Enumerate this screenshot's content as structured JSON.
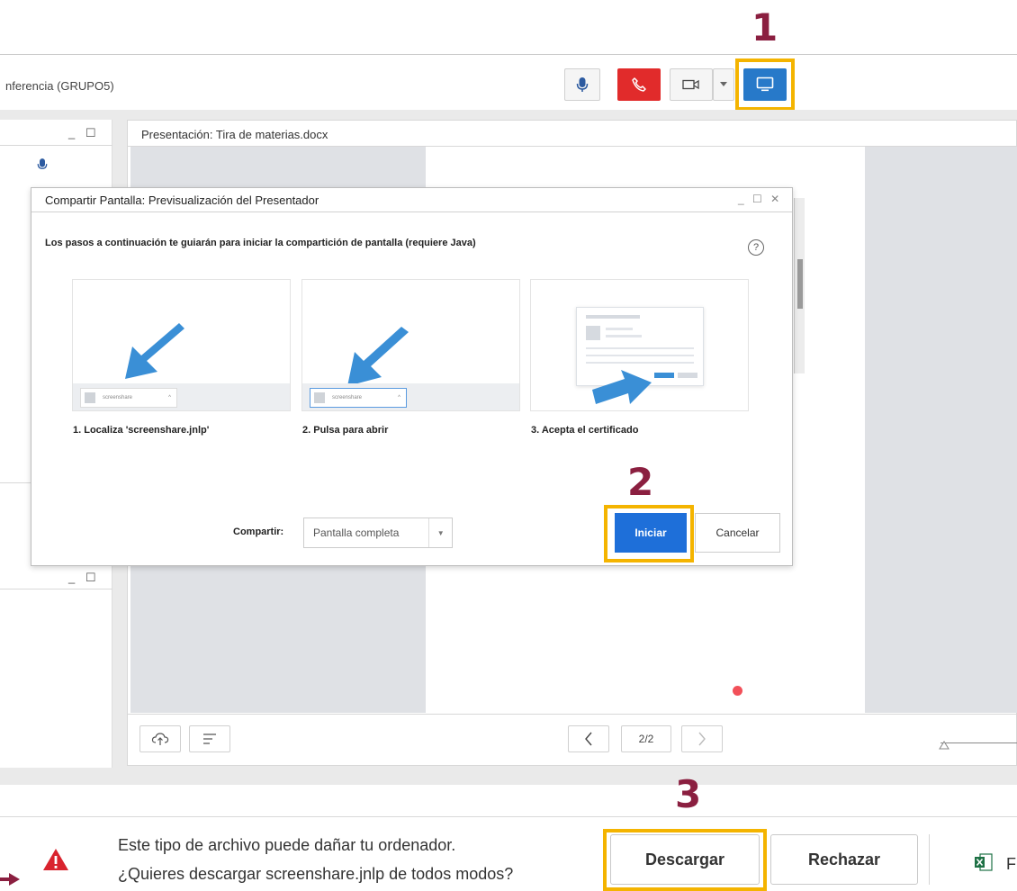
{
  "header": {
    "conference_title": "nferencia (GRUPO5)"
  },
  "steps": {
    "one": "1",
    "two": "2",
    "three": "3"
  },
  "presentation": {
    "title": "Presentación: Tira de materias.docx",
    "page_indicator": "2/2"
  },
  "dialog": {
    "title": "Compartir Pantalla: Previsualización del Presentador",
    "description": "Los pasos a continuación te guiarán para iniciar la compartición de pantalla (requiere Java)",
    "help": "?",
    "cards": [
      {
        "label": "1. Localiza 'screenshare.jnlp'",
        "file": "screenshare"
      },
      {
        "label": "2. Pulsa para abrir",
        "file": "screenshare"
      },
      {
        "label": "3. Acepta el certificado"
      }
    ],
    "share_label": "Compartir:",
    "share_value": "Pantalla completa",
    "start_label": "Iniciar",
    "cancel_label": "Cancelar"
  },
  "download_bar": {
    "line1": "Este tipo de archivo puede dañar tu ordenador.",
    "line2": "¿Quieres descargar screenshare.jnlp de todos modos?",
    "accept_label": "Descargar",
    "reject_label": "Rechazar",
    "trailing_text": "F"
  },
  "colors": {
    "accent_blue": "#1e6fd9",
    "hangup_red": "#e12b2b",
    "highlight_yellow": "#f4b400",
    "step_number": "#8b1f40",
    "arrow_blue": "#3a8fd6"
  },
  "icons": [
    "microphone-icon",
    "phone-icon",
    "camera-icon",
    "monitor-icon",
    "help-icon",
    "cloud-upload-icon",
    "list-icon",
    "chevron-left-icon",
    "chevron-right-icon",
    "warning-icon",
    "excel-icon"
  ]
}
